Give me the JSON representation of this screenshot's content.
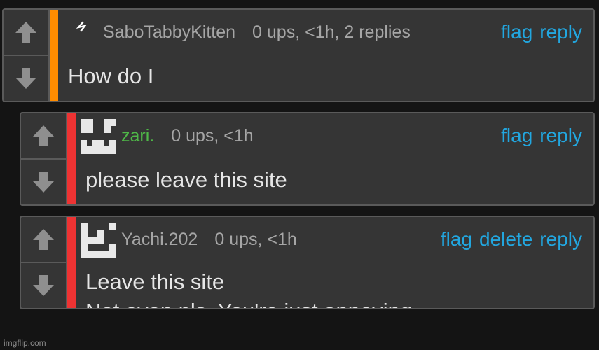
{
  "comments": [
    {
      "username": "SaboTabbyKitten",
      "stats": "0 ups, <1h, 2 replies",
      "actions": [
        "flag",
        "reply"
      ],
      "body": [
        "How do I"
      ],
      "stripe_color": "#ff8c00",
      "username_color": "#a6a6a6",
      "avatar": "lightning-icon"
    },
    {
      "username": "zari.",
      "stats": "0 ups, <1h",
      "actions": [
        "flag",
        "reply"
      ],
      "body": [
        "please leave this site"
      ],
      "stripe_color": "#ee3333",
      "username_color": "#4fb848",
      "avatar": "pixel-avatar"
    },
    {
      "username": "Yachi.202",
      "stats": "0 ups, <1h",
      "actions": [
        "flag",
        "delete",
        "reply"
      ],
      "body": [
        "Leave this site",
        "Not even pls. You're just annoying"
      ],
      "stripe_color": "#ee3333",
      "username_color": "#a6a6a6",
      "avatar": "pixel-avatar"
    }
  ],
  "icons": {
    "upvote": "arrow-up-icon",
    "downvote": "arrow-down-icon"
  },
  "colors": {
    "link": "#22a7e0",
    "background": "#141414",
    "card": "#353535"
  },
  "watermark": "imgflip.com"
}
